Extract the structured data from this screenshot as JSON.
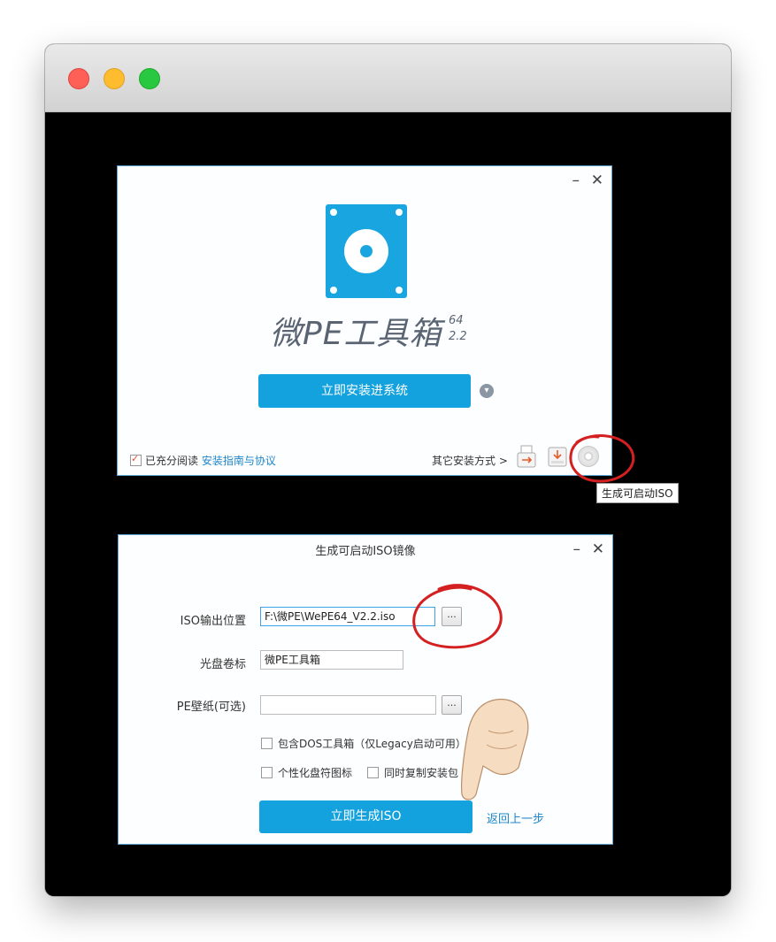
{
  "installer": {
    "brand": "微PE工具箱",
    "version_top": "64",
    "version_bottom": "2.2",
    "minimize": "–",
    "close": "✕",
    "install_button": "立即安装进系统",
    "expand_icon": "chevron-down-icon",
    "agree_prefix": "已充分阅读",
    "agree_link": "安装指南与协议",
    "other_methods": "其它安装方式 >",
    "tooltip": "生成可启动ISO"
  },
  "iso_dialog": {
    "title": "生成可启动ISO镜像",
    "minimize": "–",
    "close": "✕",
    "iso_label": "ISO输出位置",
    "iso_value": "F:\\微PE\\WePE64_V2.2.iso",
    "browse": "...",
    "volume_label": "光盘卷标",
    "volume_value": "微PE工具箱",
    "wallpaper_label": "PE壁纸(可选)",
    "wallpaper_value": "",
    "opt_dos": "包含DOS工具箱（仅Legacy启动可用）",
    "opt_icon": "个性化盘符图标",
    "opt_copy": "同时复制安装包",
    "generate_button": "立即生成ISO",
    "back_link": "返回上一步"
  },
  "colors": {
    "accent": "#13a2dd",
    "link": "#1e86c8",
    "annotation": "#d42020"
  }
}
